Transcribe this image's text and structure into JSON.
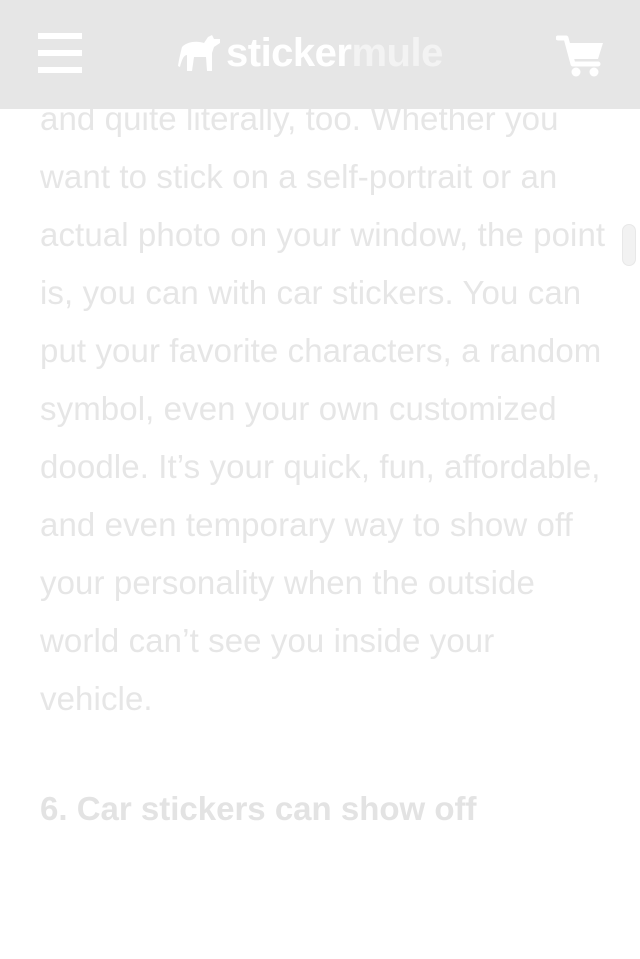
{
  "header": {
    "logo_part1": "sticker",
    "logo_part2": "mule",
    "menu_icon": "hamburger-menu-icon",
    "cart_icon": "shopping-cart-icon",
    "logo_icon": "mule-logo-icon"
  },
  "article": {
    "paragraph": "and quite literally, too. Whether you want to stick on a self-portrait or an actual photo on your window, the point is, you can with car stickers. You can put your favorite characters, a random symbol, even your own customized doodle. It’s your quick, fun, affordable, and even temporary way to show off your personality when the outside world can’t see you inside your vehicle.",
    "heading": "6. Car stickers can show off"
  },
  "colors": {
    "header_bg": "#e6e6e6",
    "text": "#e6e6e6",
    "icons": "#ffffff"
  }
}
